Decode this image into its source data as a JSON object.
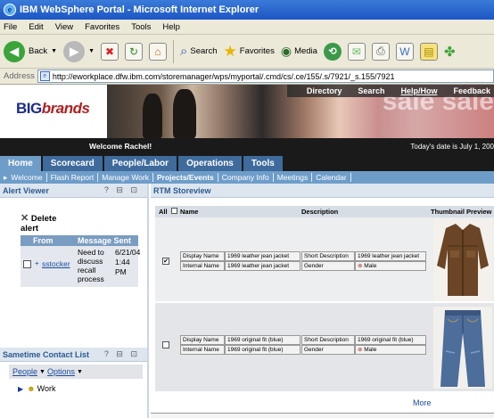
{
  "window": {
    "title": "IBM WebSphere Portal - Microsoft Internet Explorer"
  },
  "menu": [
    "File",
    "Edit",
    "View",
    "Favorites",
    "Tools",
    "Help"
  ],
  "toolbar": {
    "back": "Back",
    "search": "Search",
    "favorites": "Favorites",
    "media": "Media"
  },
  "address": {
    "label": "Address",
    "url": "http://eworkplace.dfw.ibm.com/storemanager/wps/myportal/.cmd/cs/.ce/155/.s/7921/_s.155/7921"
  },
  "banner": {
    "logo_prefix": "BIG",
    "logo_brand": "brands",
    "links": [
      "Directory",
      "Search",
      "Help/How",
      "Feedback"
    ],
    "sale_text": "sale sale"
  },
  "welcome": {
    "text": "Welcome Rachel!",
    "date": "Today's date is July 1, 200"
  },
  "tabs": [
    "Home",
    "Scorecard",
    "People/Labor",
    "Operations",
    "Tools"
  ],
  "subnav": [
    "Welcome",
    "Flash Report",
    "Manage Work",
    "Projects/Events",
    "Company Info",
    "Meetings",
    "Calendar"
  ],
  "alert_viewer": {
    "title": "Alert Viewer",
    "controls": "? ⊟ ⊡",
    "delete_label": "Delete",
    "delete_suffix": "alert",
    "col_from": "From",
    "col_message": "Message Sent",
    "row": {
      "from": "sstocker",
      "message": "Need to discuss recall process",
      "date": "6/21/04",
      "time": "1:44 PM"
    }
  },
  "sametime": {
    "title": "Sametime Contact List",
    "controls": "? ⊟ ⊡",
    "people": "People",
    "options": "Options",
    "group": "Work"
  },
  "storeview": {
    "title": "RTM Storeview",
    "col_all": "All",
    "col_name": "Name",
    "col_description": "Description",
    "col_preview": "Thumbnail Preview",
    "rows": [
      {
        "checked": "✔",
        "display_label": "Display Name",
        "display_value": "1969 leather jean jacket",
        "internal_label": "Internal Name",
        "internal_value": "1969 leather jean jacket",
        "short_label": "Short Description",
        "short_value": "1969 leather jean jacket",
        "gender_label": "Gender",
        "gender_value": "Male"
      },
      {
        "checked": "",
        "display_label": "Display Name",
        "display_value": "1969 original fit (blue)",
        "internal_label": "Internal Name",
        "internal_value": "1969 original fit (blue)",
        "short_label": "Short Description",
        "short_value": "1969 original fit (blue)",
        "gender_label": "Gender",
        "gender_value": "Male"
      }
    ],
    "more": "More"
  },
  "colors": {
    "tab_bar": "#3f6b9c",
    "tab_active": "#6f9dc9",
    "header_text": "#2b5a8f"
  }
}
